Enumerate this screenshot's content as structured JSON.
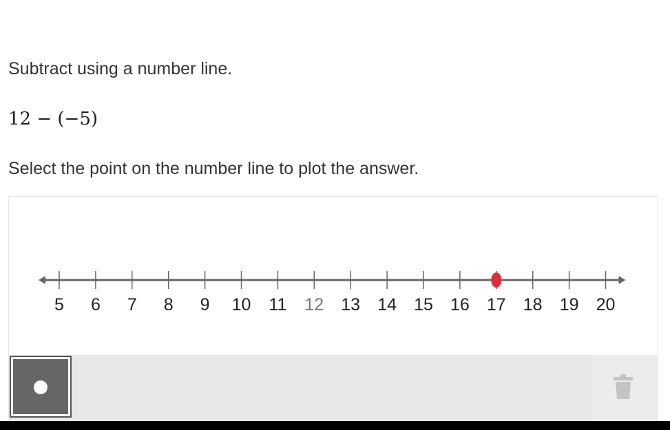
{
  "question": {
    "instruction": "Subtract using a number line.",
    "expression": "12 − (−5)",
    "prompt": "Select the point on the number line to plot the answer."
  },
  "number_line": {
    "ticks": [
      "5",
      "6",
      "7",
      "8",
      "9",
      "10",
      "11",
      "12",
      "13",
      "14",
      "15",
      "16",
      "17",
      "18",
      "19",
      "20"
    ],
    "highlighted_tick": "12",
    "plotted_point_value": 17,
    "point_color": "#d9303c",
    "axis_color": "#666666"
  },
  "toolbar": {
    "point_tool_icon": "point-tool-icon",
    "point_tool_selected": true,
    "delete_icon": "trash-icon"
  }
}
